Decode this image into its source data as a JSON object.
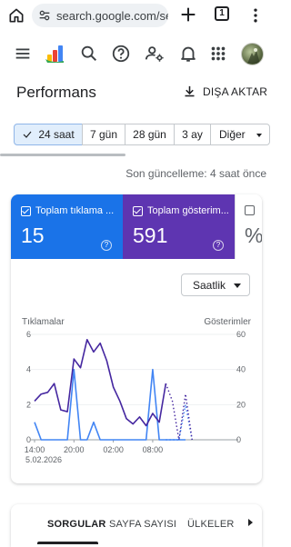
{
  "browser": {
    "url": "search.google.com/se",
    "tab_count": "1"
  },
  "page": {
    "title": "Performans",
    "export_label": "DIŞA AKTAR",
    "last_updated": "Son güncelleme: 4 saat önce"
  },
  "filters": {
    "chips": [
      "24 saat",
      "7 gün",
      "28 gün",
      "3 ay",
      "Diğer"
    ],
    "selected": "24 saat"
  },
  "metrics": [
    {
      "label": "Toplam tıklama ...",
      "value": "15",
      "color": "#1a73e8",
      "checked": true
    },
    {
      "label": "Toplam gösterim...",
      "value": "591",
      "color": "#5e35b1",
      "checked": true
    },
    {
      "label": "",
      "value": "%",
      "color": "#ffffff",
      "checked": false
    }
  ],
  "granularity": {
    "selected": "Saatlik"
  },
  "chart_data": {
    "type": "line",
    "left_axis_label": "Tıklamalar",
    "right_axis_label": "Gösterimler",
    "x_ticks": [
      "14:00",
      "20:00",
      "02:00",
      "08:00"
    ],
    "date_label": "5.02.2026",
    "left_ticks": [
      "6",
      "4",
      "2",
      "0"
    ],
    "right_ticks": [
      "60",
      "40",
      "20",
      "0"
    ],
    "left_ylim": [
      0,
      6
    ],
    "right_ylim": [
      0,
      60
    ],
    "x": [
      "14:00",
      "15:00",
      "16:00",
      "17:00",
      "18:00",
      "19:00",
      "20:00",
      "21:00",
      "22:00",
      "23:00",
      "00:00",
      "01:00",
      "02:00",
      "03:00",
      "04:00",
      "05:00",
      "06:00",
      "07:00",
      "08:00",
      "09:00",
      "10:00",
      "11:00",
      "12:00",
      "13:00"
    ],
    "series": [
      {
        "name": "Tıklamalar",
        "axis": "left",
        "color": "#4285f4",
        "values": [
          1,
          0,
          0,
          0,
          0,
          0,
          4,
          0,
          0,
          1,
          0,
          0,
          0,
          0,
          0,
          0,
          0,
          0,
          4,
          0,
          0,
          0,
          0,
          0
        ],
        "projected_from_index": 20,
        "projected": [
          0,
          0,
          0,
          2,
          0
        ]
      },
      {
        "name": "Gösterimler",
        "axis": "right",
        "color": "#4527a0",
        "values": [
          22,
          26,
          27,
          32,
          17,
          16,
          46,
          41,
          57,
          50,
          55,
          45,
          30,
          22,
          12,
          9,
          13,
          8,
          15,
          10,
          32
        ],
        "projected_from_index": 20,
        "projected": [
          32,
          22,
          0,
          26,
          0
        ]
      }
    ]
  },
  "tabs": {
    "items": [
      "SORGULAR",
      "SAYFA SAYISI",
      "ÜLKELER"
    ],
    "active": "SORGULAR"
  }
}
